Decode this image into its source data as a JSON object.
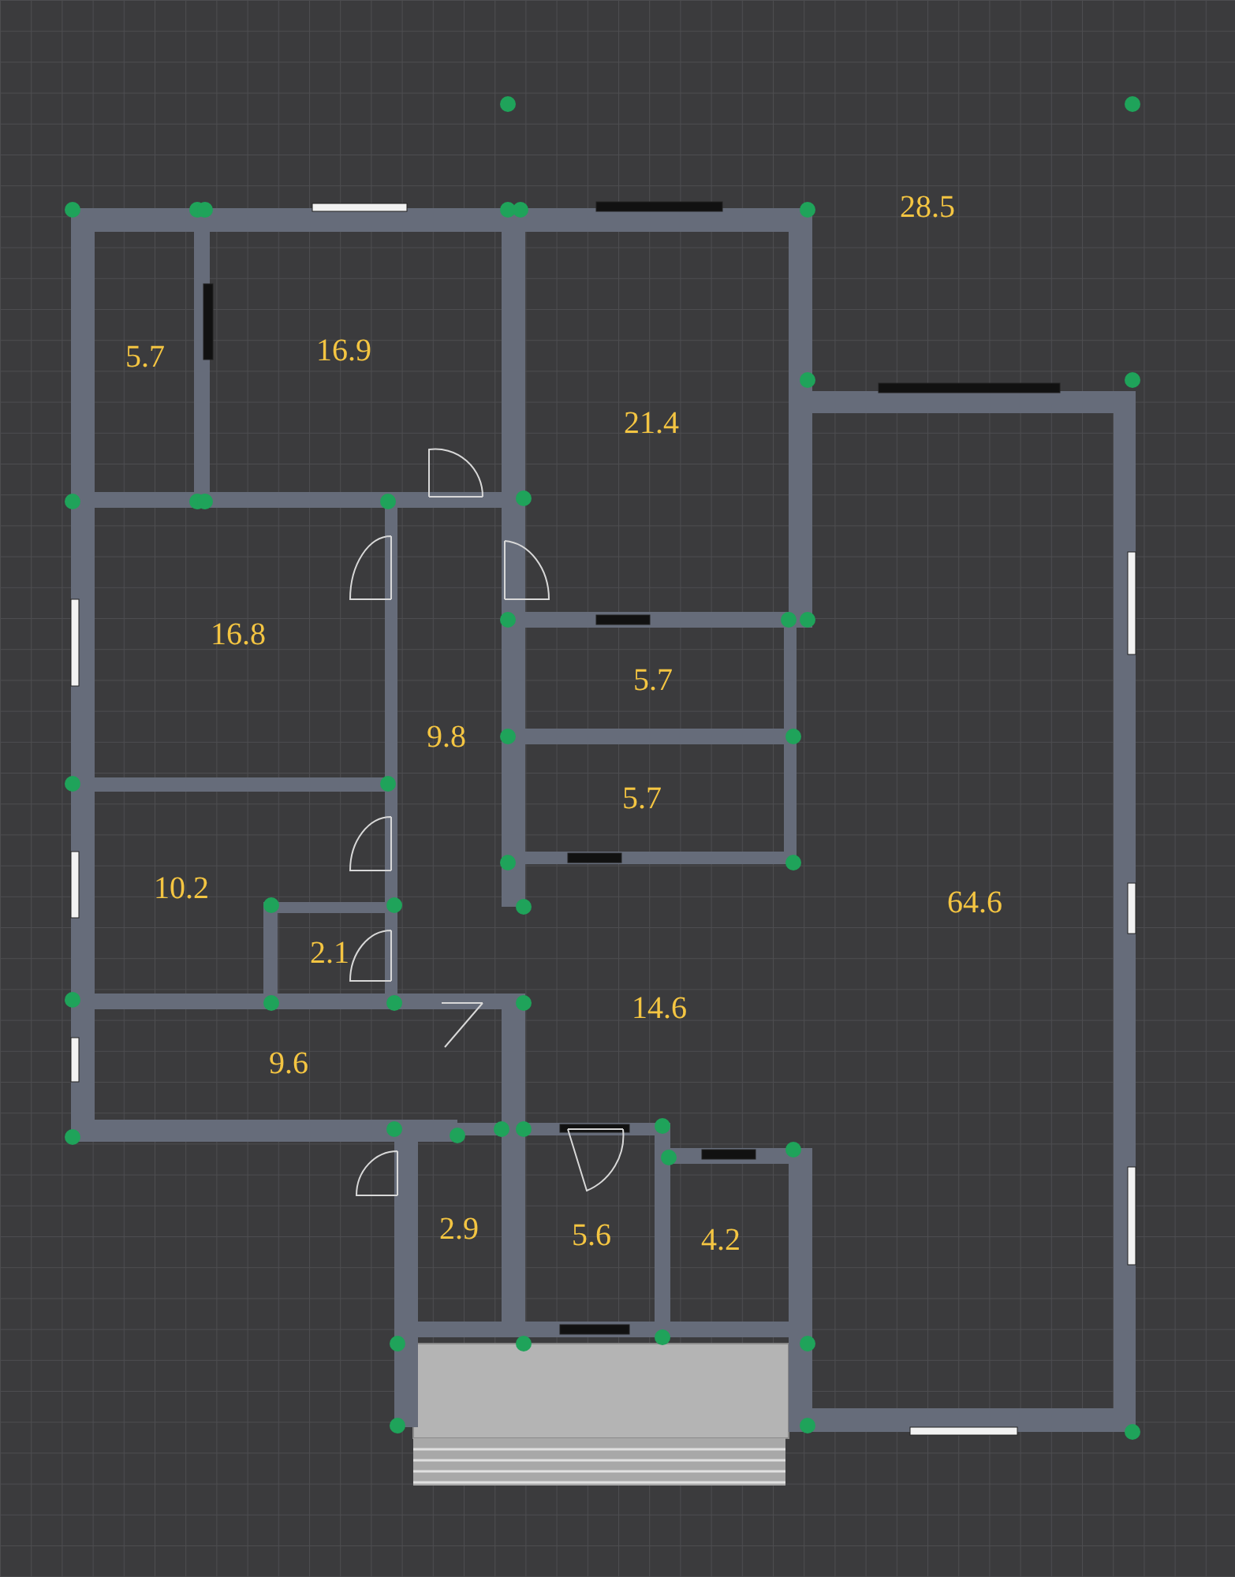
{
  "rooms": [
    {
      "area": "5.7"
    },
    {
      "area": "16.9"
    },
    {
      "area": "21.4"
    },
    {
      "area": "28.5"
    },
    {
      "area": "16.8"
    },
    {
      "area": "9.8"
    },
    {
      "area": "5.7"
    },
    {
      "area": "5.7"
    },
    {
      "area": "10.2"
    },
    {
      "area": "2.1"
    },
    {
      "area": "64.6"
    },
    {
      "area": "14.6"
    },
    {
      "area": "9.6"
    },
    {
      "area": "2.9"
    },
    {
      "area": "5.6"
    },
    {
      "area": "4.2"
    }
  ]
}
